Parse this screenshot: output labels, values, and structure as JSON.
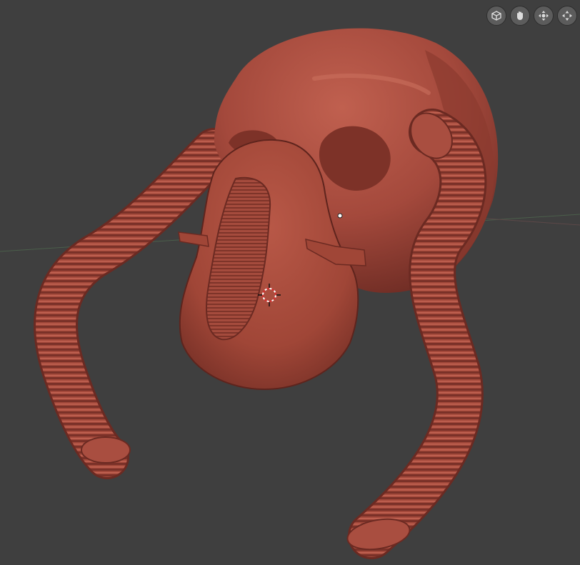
{
  "app": {
    "viewport_background": "#3f3f3f",
    "grid_axis_x_color": "#5f4a4a",
    "grid_axis_y_color": "#4a5f4a"
  },
  "model": {
    "material_color": "#a4493c",
    "highlight_color": "#c86a5a",
    "shadow_color": "#6b2a22"
  },
  "navigation_gizmo": {
    "buttons": [
      {
        "icon": "camera-view-icon"
      },
      {
        "icon": "pan-hand-icon"
      },
      {
        "icon": "move-view-icon"
      },
      {
        "icon": "zoom-view-icon"
      }
    ]
  },
  "cursor_3d": {
    "primary_color": "#d43030",
    "secondary_color": "#ffffff"
  }
}
